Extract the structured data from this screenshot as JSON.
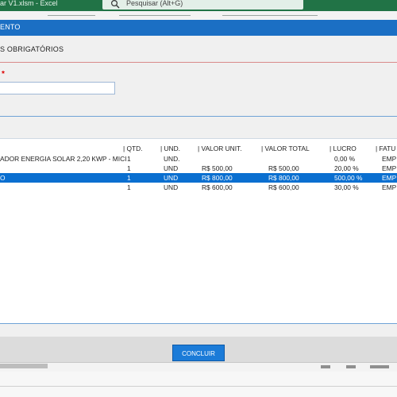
{
  "excel": {
    "title": "ar V1.xlsm  -  Excel",
    "search_placeholder": "Pesquisar (Alt+G)"
  },
  "form": {
    "title": "ENTO",
    "section_label": "S OBRIGATÓRIOS",
    "required_mark": "*",
    "input_value": ""
  },
  "grid": {
    "headers": [
      "| QTD.",
      "| UND.",
      "| VALOR UNIT.",
      "| VALOR TOTAL",
      "| LUCRO",
      "| FATU"
    ],
    "rows": [
      {
        "desc": "ADOR ENERGIA SOLAR 2,20 KWP - MICI",
        "qtd": "1",
        "und": "UND.",
        "vunit": "",
        "vtotal": "",
        "lucro": "0,00 %",
        "fatu": "EMP"
      },
      {
        "desc": "",
        "qtd": "1",
        "und": "UND",
        "vunit": "R$ 500,00",
        "vtotal": "R$ 500,00",
        "lucro": "20,00 %",
        "fatu": "EMP"
      },
      {
        "desc": "O",
        "qtd": "1",
        "und": "UND",
        "vunit": "R$ 800,00",
        "vtotal": "R$ 800,00",
        "lucro": "500,00 %",
        "fatu": "EMP",
        "selected": true
      },
      {
        "desc": "",
        "qtd": "1",
        "und": "UND",
        "vunit": "R$ 600,00",
        "vtotal": "R$ 600,00",
        "lucro": "30,00 %",
        "fatu": "EMP"
      }
    ]
  },
  "footer": {
    "conclude_label": "CONCLUIR"
  },
  "colors": {
    "excel_green": "#217346",
    "form_blue": "#1b6fc4",
    "selection_blue": "#0a6fd0"
  }
}
